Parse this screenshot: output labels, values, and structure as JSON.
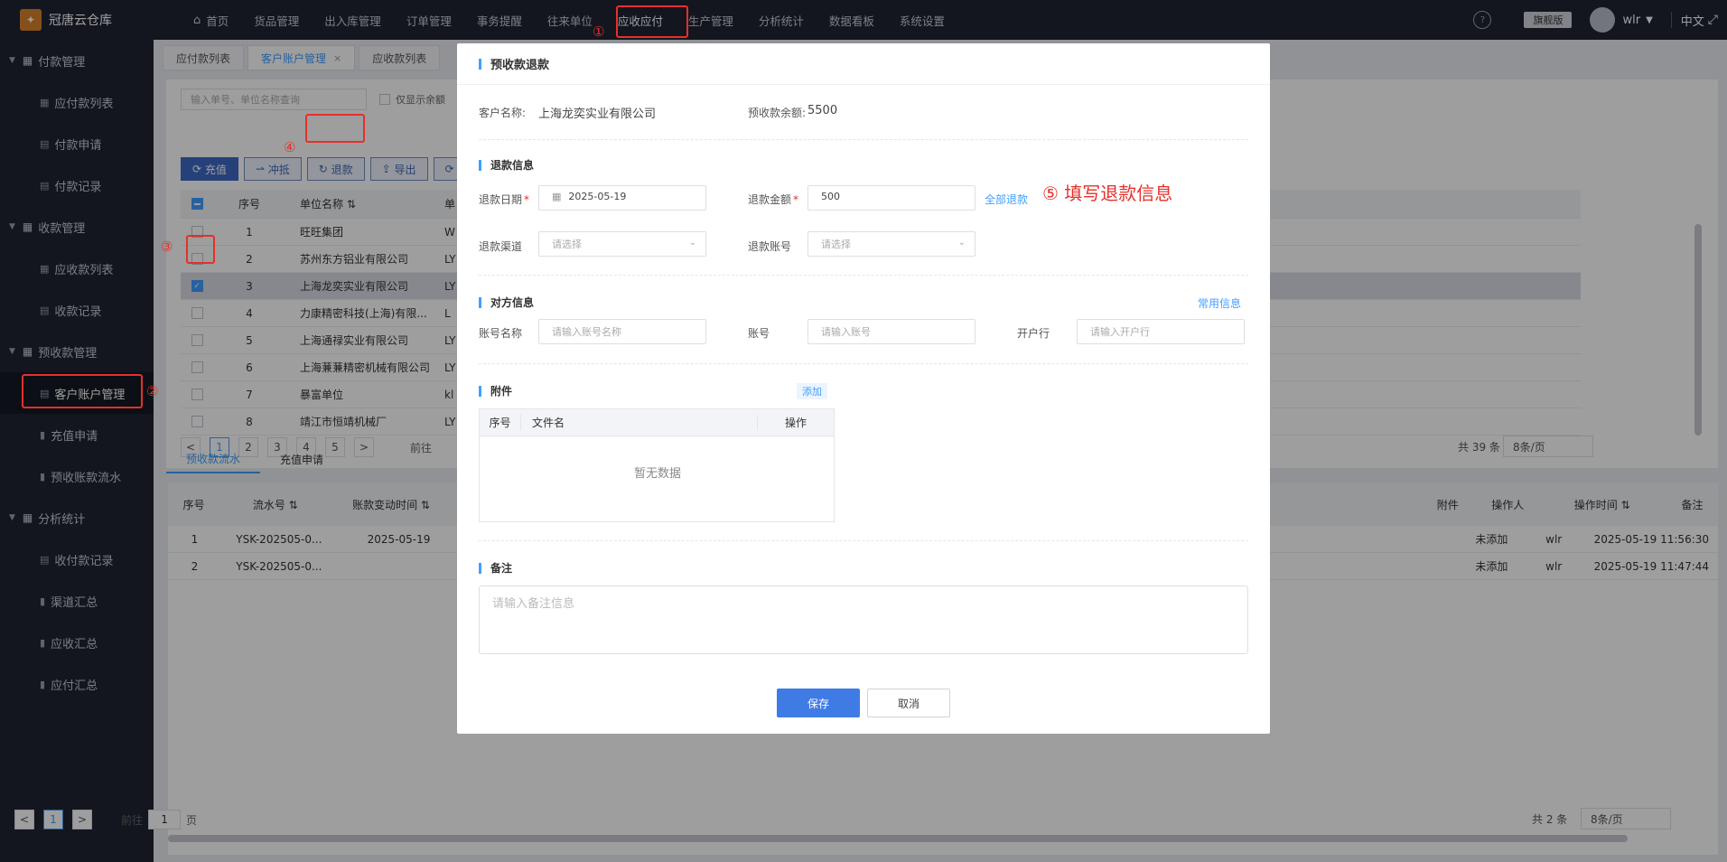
{
  "app": {
    "brand": "冠唐云仓库"
  },
  "nav": {
    "items": [
      "首页",
      "货品管理",
      "出入库管理",
      "订单管理",
      "事务提醒",
      "往来单位",
      "应收应付",
      "生产管理",
      "分析统计",
      "数据看板",
      "系统设置"
    ],
    "active": "应收应付",
    "edition": "旗舰版",
    "user": "wlr",
    "lang": "中文"
  },
  "sidebar": {
    "groups": [
      {
        "label": "付款管理",
        "items": [
          "应付款列表",
          "付款申请",
          "付款记录"
        ]
      },
      {
        "label": "收款管理",
        "items": [
          "应收款列表",
          "收款记录"
        ]
      },
      {
        "label": "预收款管理",
        "items": [
          "客户账户管理",
          "充值申请",
          "预收账款流水"
        ]
      },
      {
        "label": "分析统计",
        "items": [
          "收付款记录",
          "渠道汇总",
          "应收汇总",
          "应付汇总"
        ]
      }
    ],
    "active": "客户账户管理"
  },
  "tabs": [
    {
      "label": "应付款列表"
    },
    {
      "label": "客户账户管理",
      "close": "×"
    },
    {
      "label": "应收款列表"
    }
  ],
  "toolbar": {
    "search_placeholder": "输入单号、单位名称查询",
    "only_show": "仅显示余额",
    "buttons": [
      "充值",
      "冲抵",
      "退款",
      "导出",
      "⟳"
    ]
  },
  "top_table": {
    "headers": [
      "序号",
      "单位名称",
      "单"
    ],
    "rows": [
      {
        "no": "1",
        "name": "旺旺集团",
        "rest": "W"
      },
      {
        "no": "2",
        "name": "苏州东方铝业有限公司",
        "rest": "LY"
      },
      {
        "no": "3",
        "name": "上海龙奕实业有限公司",
        "rest": "LY"
      },
      {
        "no": "4",
        "name": "力康精密科技(上海)有限...",
        "rest": "L"
      },
      {
        "no": "5",
        "name": "上海通禄实业有限公司",
        "rest": "LY"
      },
      {
        "no": "6",
        "name": "上海蒹蒹精密机械有限公司",
        "rest": "LY"
      },
      {
        "no": "7",
        "name": "暴富单位",
        "rest": "kl"
      },
      {
        "no": "8",
        "name": "靖江市恒靖机械厂",
        "rest": "LY"
      }
    ],
    "selected_index": 2
  },
  "pager_top": {
    "pages": [
      "1",
      "2",
      "3",
      "4",
      "5"
    ],
    "next": ">",
    "prev": "<",
    "goto": "前往",
    "total": "共 39 条",
    "size": "8条/页"
  },
  "subtabs": [
    "预收款流水",
    "充值申请"
  ],
  "bottom_table": {
    "headers": [
      "序号",
      "流水号",
      "账款变动时间",
      "附件",
      "操作人",
      "操作时间",
      "备注"
    ],
    "rows": [
      {
        "no": "1",
        "serial": "YSK-202505-0...",
        "time": "2025-05-19",
        "attach": "未添加",
        "op": "wlr",
        "optime": "2025-05-19 11:56:30"
      },
      {
        "no": "2",
        "serial": "YSK-202505-0...",
        "time": "",
        "attach": "未添加",
        "op": "wlr",
        "optime": "2025-05-19 11:47:44"
      }
    ]
  },
  "pager_bottom": {
    "page": "1",
    "goto": "前往",
    "goto_value": "1",
    "unit": "页",
    "total": "共 2 条",
    "size": "8条/页"
  },
  "modal": {
    "title": "预收款退款",
    "customer_label": "客户名称:",
    "customer_value": "上海龙奕实业有限公司",
    "balance_label": "预收款余额:",
    "balance_value": "5500",
    "refund_section": "退款信息",
    "date_label": "退款日期",
    "date_value": "2025-05-19",
    "amount_label": "退款金额",
    "amount_value": "500",
    "refund_all": "全部退款",
    "channel_label": "退款渠道",
    "channel_placeholder": "请选择",
    "account_label": "退款账号",
    "account_placeholder": "请选择",
    "party_section": "对方信息",
    "common_info": "常用信息",
    "acct_name_label": "账号名称",
    "acct_name_placeholder": "请输入账号名称",
    "acct_no_label": "账号",
    "acct_no_placeholder": "请输入账号",
    "bank_label": "开户行",
    "bank_placeholder": "请输入开户行",
    "attach_section": "附件",
    "attach_add": "添加",
    "attach_headers": [
      "序号",
      "文件名",
      "操作"
    ],
    "attach_empty": "暂无数据",
    "remark_section": "备注",
    "remark_placeholder": "请输入备注信息",
    "save": "保存",
    "cancel": "取消"
  },
  "annotations": {
    "n1": "①",
    "n2": "②",
    "n3": "③",
    "n4": "④",
    "step5": "⑤ 填写退款信息"
  },
  "colors": {
    "accent": "#409eff",
    "annotation": "#e5302a",
    "nav_bg": "#1f2533"
  }
}
